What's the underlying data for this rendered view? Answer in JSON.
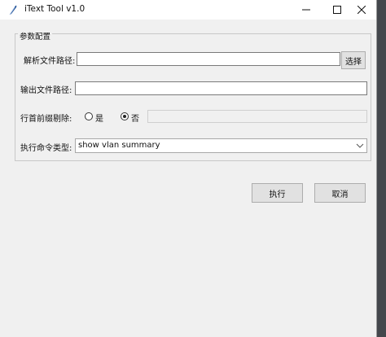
{
  "window": {
    "title": "iText Tool  v1.0",
    "icon": "feather-icon",
    "controls": [
      "minimize-icon",
      "maximize-icon",
      "close-icon"
    ]
  },
  "config": {
    "group_title": "参数配置",
    "parse_path": {
      "label": "解析文件路径:",
      "value": "",
      "button": "选择"
    },
    "output_path": {
      "label": "输出文件路径:",
      "value": ""
    },
    "strip_prefix": {
      "label": "行首前缀剔除:",
      "options": [
        "是",
        "否"
      ],
      "selected": "否",
      "value": ""
    },
    "command_type": {
      "label": "执行命令类型:",
      "selected": "show vlan summary"
    }
  },
  "actions": {
    "run": "执行",
    "cancel": "取消"
  },
  "colors": {
    "window_bg": "#f0f0f0",
    "titlebar_bg": "#ffffff",
    "button_bg": "#e1e1e1"
  }
}
